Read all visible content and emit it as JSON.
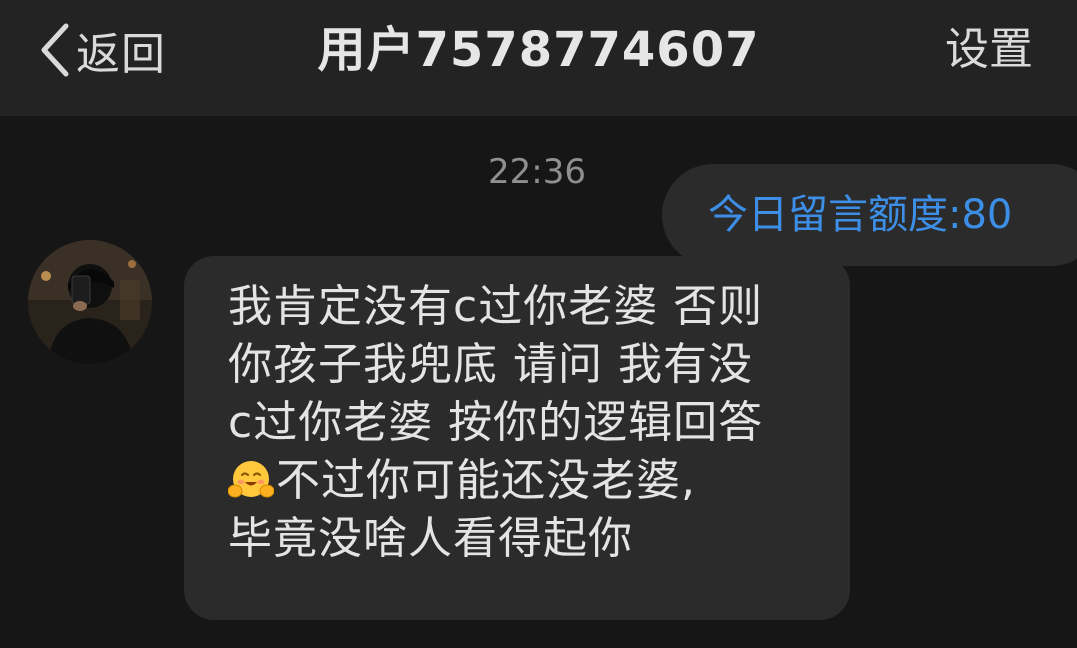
{
  "header": {
    "back_label": "返回",
    "title": "用户7578774607",
    "settings_label": "设置"
  },
  "chat": {
    "timestamp": "22:36",
    "system_notice": "今日留言额度:80",
    "system_notice_color": "#3d8ee6",
    "incoming_message": {
      "avatar_icon": "user-avatar-photo",
      "lines": [
        "我肯定没有c过你老婆 否则",
        "你孩子我兜底 请问 我有没",
        "c过你老婆 按你的逻辑回答",
        "不过你可能还没老婆,",
        "毕竟没啥人看得起你"
      ],
      "emoji_icon": "hugging-face-emoji"
    }
  },
  "colors": {
    "background": "#161616",
    "navbar": "#232323",
    "bubble": "#2b2b2b",
    "text_primary": "#e4e4e4",
    "timestamp": "#8f8f8f",
    "accent_blue": "#3d8ee6"
  }
}
